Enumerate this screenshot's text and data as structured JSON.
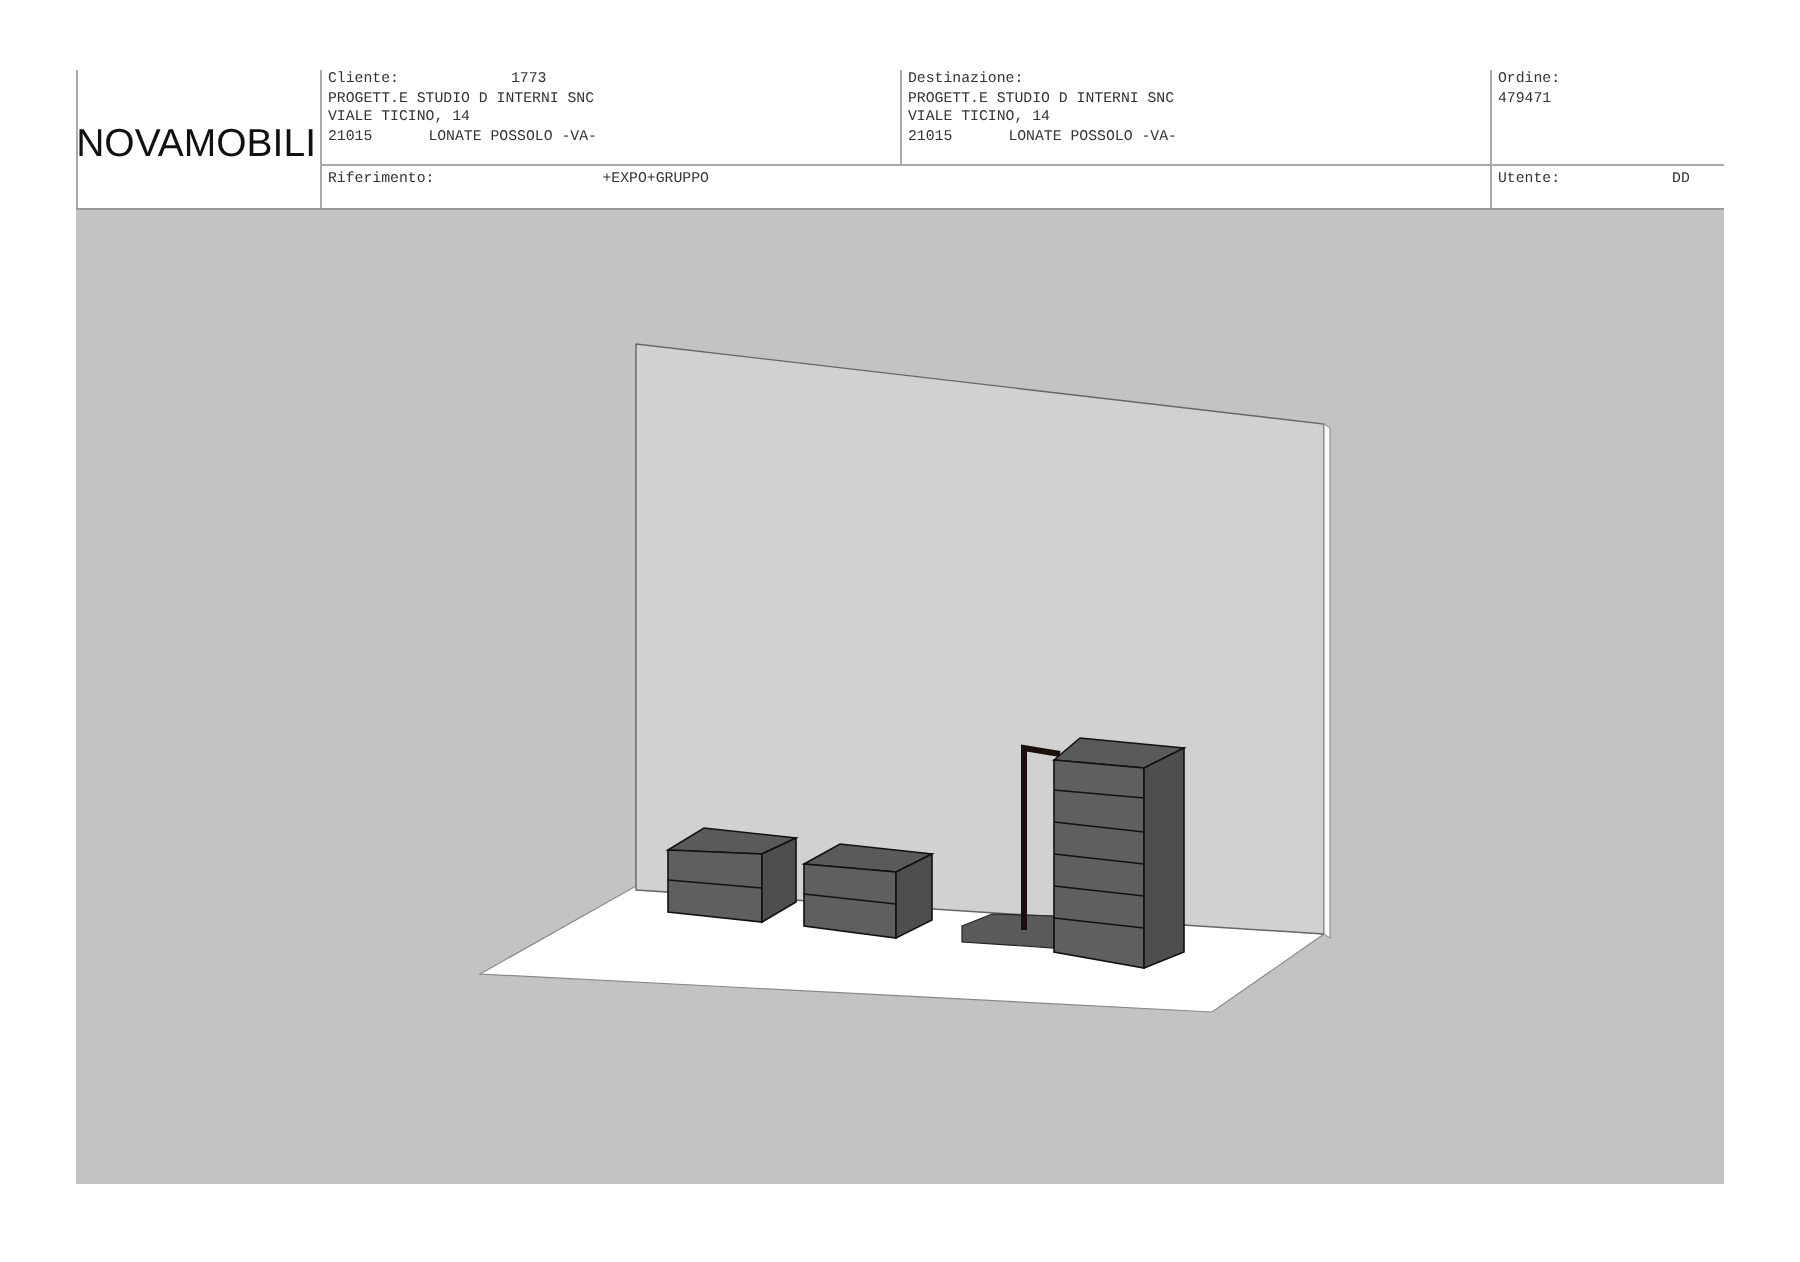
{
  "header": {
    "logo": "NOVAMOBILI",
    "cliente": {
      "label": "Cliente:",
      "value": "1773",
      "lines": [
        "PROGETT.E STUDIO D INTERNI SNC",
        "VIALE TICINO, 14"
      ],
      "cap": "21015",
      "city": "LONATE POSSOLO -VA-"
    },
    "destinazione": {
      "label": "Destinazione:",
      "lines": [
        "PROGETT.E STUDIO D INTERNI SNC",
        "VIALE TICINO, 14"
      ],
      "cap": "21015",
      "city": "LONATE POSSOLO -VA-"
    },
    "ordine": {
      "label": "Ordine:",
      "value": "479471"
    },
    "riferimento": {
      "label": "Riferimento:",
      "value": "+EXPO+GRUPPO"
    },
    "utente": {
      "label": "Utente:",
      "value": "DD"
    }
  }
}
